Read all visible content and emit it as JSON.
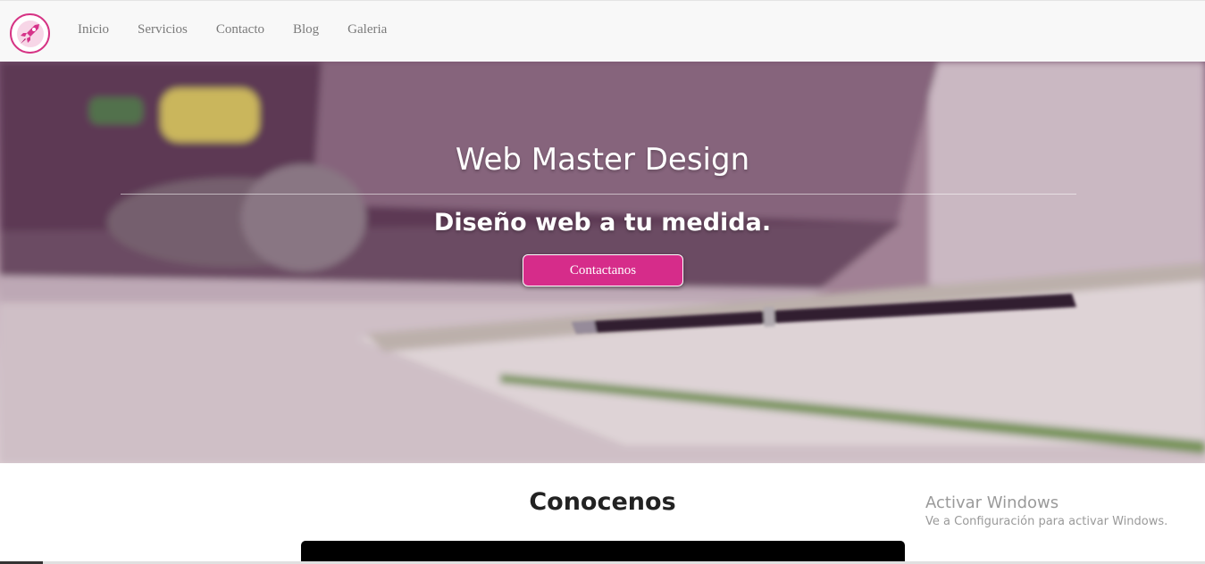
{
  "navbar": {
    "logo_icon": "rocket-icon",
    "links": [
      "Inicio",
      "Servicios",
      "Contacto",
      "Blog",
      "Galeria"
    ]
  },
  "hero": {
    "title": "Web Master Design",
    "subtitle": "Diseño web a tu medida.",
    "cta_label": "Contactanos"
  },
  "section": {
    "title": "Conocenos"
  },
  "watermark": {
    "title": "Activar Windows",
    "subtitle": "Ve a Configuración para activar Windows."
  },
  "colors": {
    "accent": "#d62c8a",
    "nav_bg": "#f8f8f8",
    "nav_text": "#7a7a7a"
  }
}
